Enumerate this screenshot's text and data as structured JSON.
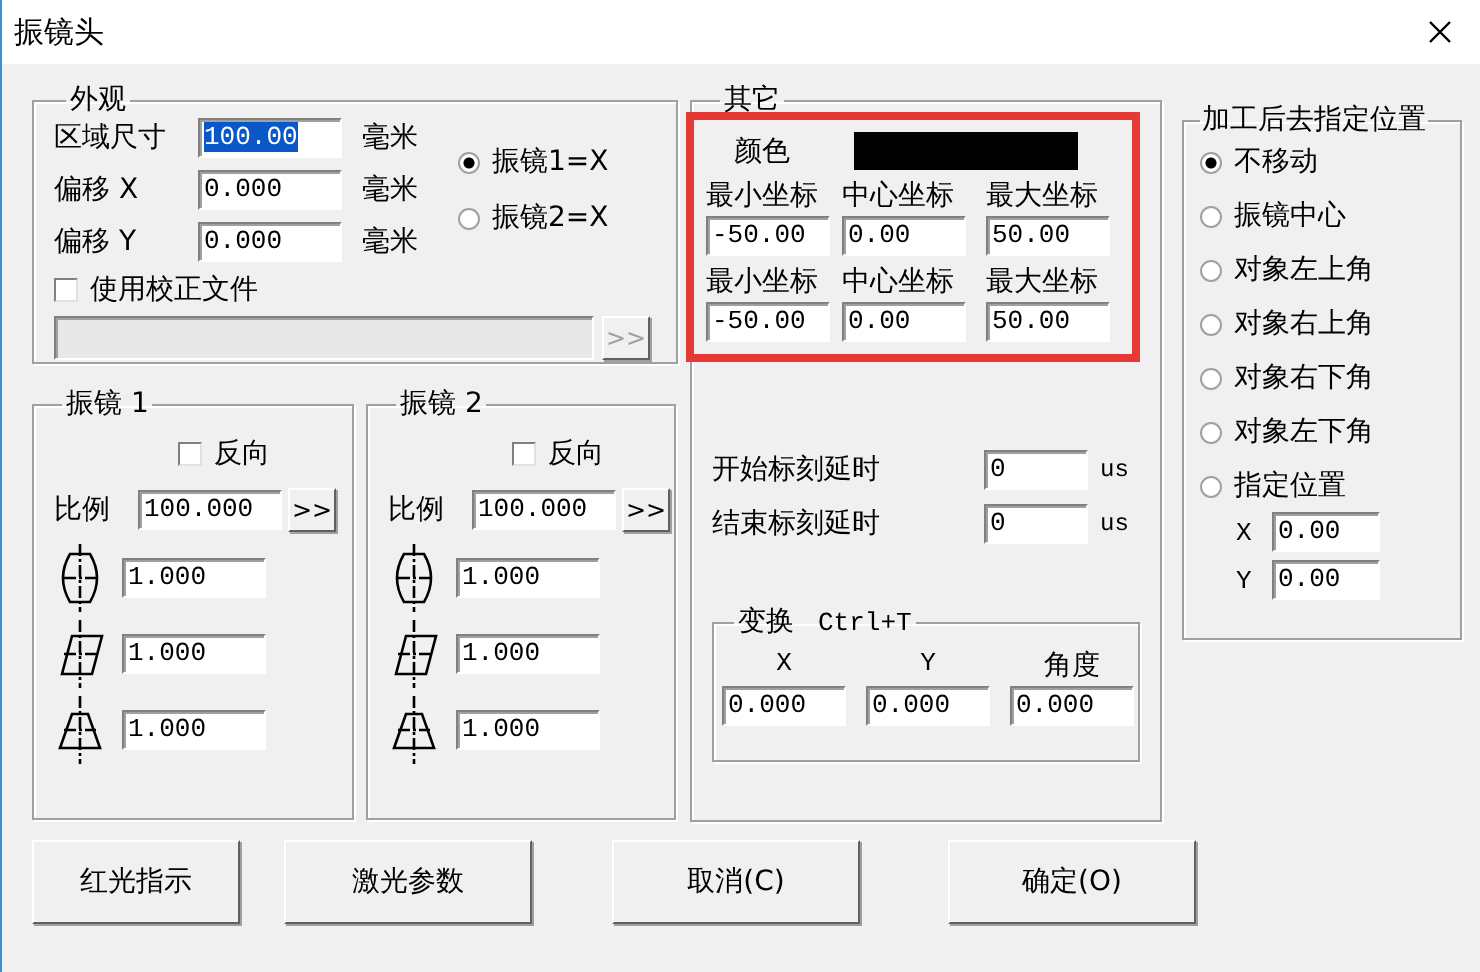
{
  "window": {
    "title": "振镜头"
  },
  "appearance": {
    "title": "外观",
    "fields": [
      {
        "label": "区域尺寸",
        "value": "100.00",
        "unit": "毫米",
        "selected": true
      },
      {
        "label": "偏移 X",
        "value": "0.000",
        "unit": "毫米",
        "selected": false
      },
      {
        "label": "偏移 Y",
        "value": "0.000",
        "unit": "毫米",
        "selected": false
      }
    ],
    "radios": [
      {
        "label": "振镜1=X",
        "selected": true
      },
      {
        "label": "振镜2=X",
        "selected": false
      }
    ],
    "checkbox": {
      "label": "使用校正文件",
      "checked": false
    },
    "file_field": {
      "disabled": true
    },
    "browse_button": {
      "label": ">>",
      "disabled": true
    }
  },
  "galvos": [
    {
      "title": "振镜 1",
      "reverse": {
        "label": "反向",
        "checked": false
      },
      "scale": {
        "label": "比例",
        "value": "100.000",
        "button": ">>"
      },
      "corrections": [
        {
          "kind": "barrel",
          "value": "1.000"
        },
        {
          "kind": "parallelogram",
          "value": "1.000"
        },
        {
          "kind": "trapezoid",
          "value": "1.000"
        }
      ]
    },
    {
      "title": "振镜 2",
      "reverse": {
        "label": "反向",
        "checked": false
      },
      "scale": {
        "label": "比例",
        "value": "100.000",
        "button": ">>"
      },
      "corrections": [
        {
          "kind": "barrel",
          "value": "1.000"
        },
        {
          "kind": "parallelogram",
          "value": "1.000"
        },
        {
          "kind": "trapezoid",
          "value": "1.000"
        }
      ]
    }
  ],
  "other": {
    "title": "其它",
    "highlighted": true,
    "color_label": "颜色",
    "color": "#000000",
    "coordinate_rows": [
      {
        "columns": [
          {
            "label": "最小坐标",
            "value": "-50.00"
          },
          {
            "label": "中心坐标",
            "value": "0.00"
          },
          {
            "label": "最大坐标",
            "value": "50.00"
          }
        ]
      },
      {
        "columns": [
          {
            "label": "最小坐标",
            "value": "-50.00"
          },
          {
            "label": "中心坐标",
            "value": "0.00"
          },
          {
            "label": "最大坐标",
            "value": "50.00"
          }
        ]
      }
    ],
    "delays": [
      {
        "label": "开始标刻延时",
        "value": "0",
        "unit": "us"
      },
      {
        "label": "结束标刻延时",
        "value": "0",
        "unit": "us"
      }
    ],
    "transform": {
      "title": "变换",
      "shortcut": "Ctrl+T",
      "fields": [
        {
          "label": "X",
          "value": "0.000"
        },
        {
          "label": "Y",
          "value": "0.000"
        },
        {
          "label": "角度",
          "value": "0.000"
        }
      ]
    }
  },
  "after_process": {
    "title": "加工后去指定位置",
    "options": [
      {
        "label": "不移动",
        "selected": true
      },
      {
        "label": "振镜中心",
        "selected": false
      },
      {
        "label": "对象左上角",
        "selected": false
      },
      {
        "label": "对象右上角",
        "selected": false
      },
      {
        "label": "对象右下角",
        "selected": false
      },
      {
        "label": "对象左下角",
        "selected": false
      },
      {
        "label": "指定位置",
        "selected": false
      }
    ],
    "position": [
      {
        "label": "X",
        "value": "0.00"
      },
      {
        "label": "Y",
        "value": "0.00"
      }
    ]
  },
  "buttons": [
    "红光指示",
    "激光参数",
    "取消(C)",
    "确定(O)"
  ]
}
